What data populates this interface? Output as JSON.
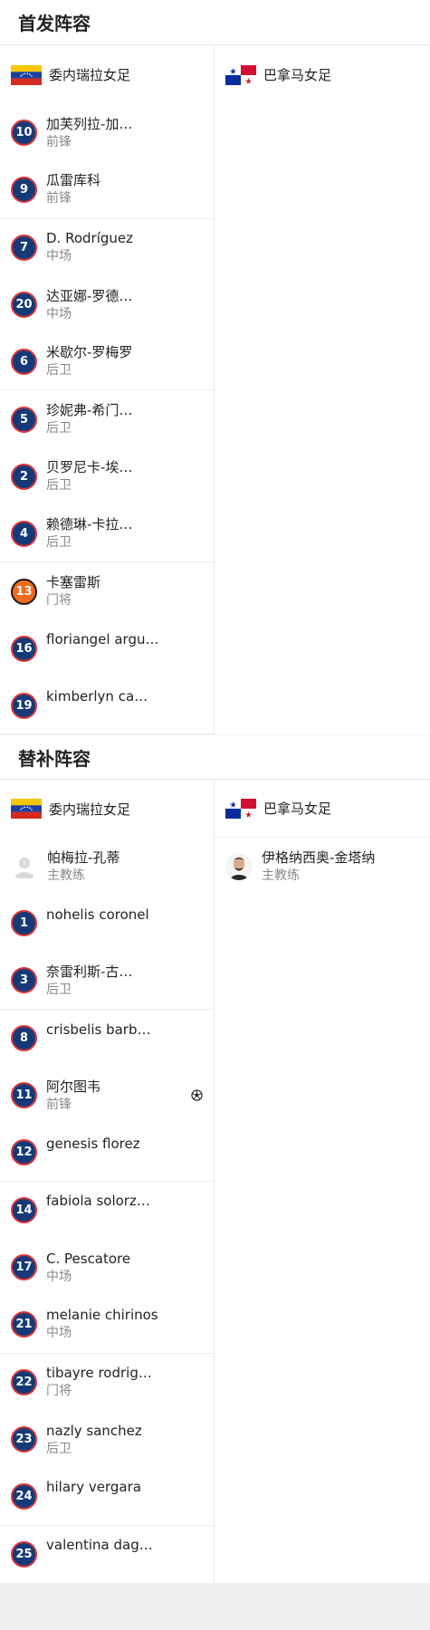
{
  "starting": {
    "title": "首发阵容",
    "home_team": "委内瑞拉女足",
    "away_team": "巴拿马女足",
    "players": [
      {
        "number": "10",
        "name": "加芙列拉-加…",
        "position": "前锋",
        "gk": false
      },
      {
        "number": "9",
        "name": "瓜雷库科",
        "position": "前锋",
        "gk": false
      },
      {
        "number": "7",
        "name": "D. Rodríguez",
        "position": "中场",
        "gk": false
      },
      {
        "number": "20",
        "name": "达亚娜-罗德…",
        "position": "中场",
        "gk": false
      },
      {
        "number": "6",
        "name": "米歇尔-罗梅罗",
        "position": "后卫",
        "gk": false
      },
      {
        "number": "5",
        "name": "珍妮弗-希门…",
        "position": "后卫",
        "gk": false
      },
      {
        "number": "2",
        "name": "贝罗尼卡-埃…",
        "position": "后卫",
        "gk": false
      },
      {
        "number": "4",
        "name": "赖德琳-卡拉…",
        "position": "后卫",
        "gk": false
      },
      {
        "number": "13",
        "name": "卡塞雷斯",
        "position": "门将",
        "gk": true
      },
      {
        "number": "16",
        "name": "floriangel argu…",
        "position": "",
        "gk": false
      },
      {
        "number": "19",
        "name": "kimberlyn ca…",
        "position": "",
        "gk": false
      }
    ]
  },
  "subs": {
    "title": "替补阵容",
    "home_team": "委内瑞拉女足",
    "away_team": "巴拿马女足",
    "home_coach": {
      "name": "帕梅拉-孔蒂",
      "role": "主教练"
    },
    "away_coach": {
      "name": "伊格纳西奥-金塔纳",
      "role": "主教练"
    },
    "players": [
      {
        "number": "1",
        "name": "nohelis coronel",
        "position": "",
        "gk": false
      },
      {
        "number": "3",
        "name": "奈雷利斯-古…",
        "position": "后卫",
        "gk": false
      },
      {
        "number": "8",
        "name": "crisbelis barb…",
        "position": "",
        "gk": false
      },
      {
        "number": "11",
        "name": "阿尔图韦",
        "position": "前锋",
        "gk": false,
        "goal_icon": "soccer-ball-icon"
      },
      {
        "number": "12",
        "name": "genesis florez",
        "position": "",
        "gk": false
      },
      {
        "number": "14",
        "name": "fabiola solorz…",
        "position": "",
        "gk": false
      },
      {
        "number": "17",
        "name": "C. Pescatore",
        "position": "中场",
        "gk": false
      },
      {
        "number": "21",
        "name": "melanie chirinos",
        "position": "中场",
        "gk": false
      },
      {
        "number": "22",
        "name": "tibayre rodrig…",
        "position": "门将",
        "gk": false
      },
      {
        "number": "23",
        "name": "nazly sanchez",
        "position": "后卫",
        "gk": false
      },
      {
        "number": "24",
        "name": "hilary vergara",
        "position": "",
        "gk": false
      },
      {
        "number": "25",
        "name": "valentina dag…",
        "position": "",
        "gk": false
      }
    ]
  },
  "colors": {
    "badge_blue": "#163a78",
    "badge_ring": "#d9383a",
    "gk_orange": "#f26a1b"
  }
}
